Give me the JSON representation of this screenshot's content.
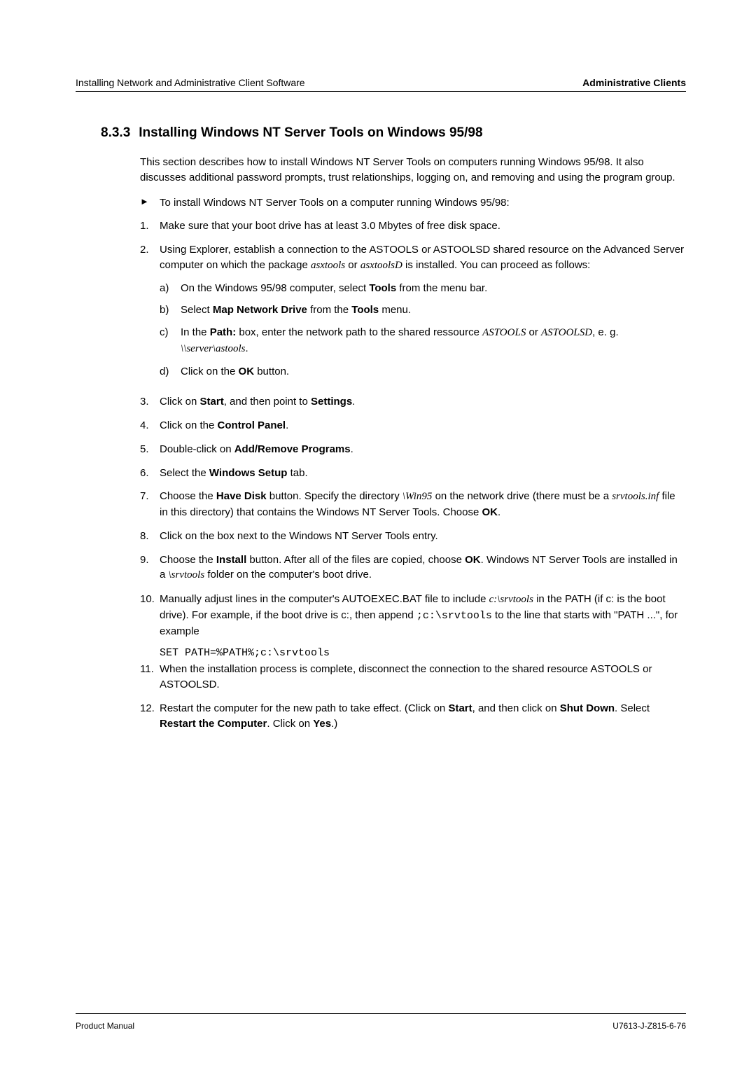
{
  "header": {
    "left": "Installing Network and Administrative Client Software",
    "right": "Administrative Clients"
  },
  "section": {
    "number": "8.3.3",
    "title": "Installing Windows NT Server Tools on Windows 95/98"
  },
  "intro": "This section describes how to install Windows NT Server Tools on computers running Windows 95/98. It also discusses additional password prompts, trust relationships, logging on, and removing and using the program group.",
  "bullet": {
    "marker": "►",
    "text": "To install Windows NT Server Tools on a computer running Windows 95/98:"
  },
  "steps": {
    "s1": "Make sure that your boot drive has at least 3.0 Mbytes of free disk space.",
    "s2_pre": "Using Explorer, establish a connection to the ASTOOLS or ASTOOLSD shared resource on the Advanced Server computer on which the package ",
    "s2_pkg1": "asxtools",
    "s2_or": " or ",
    "s2_pkg2": "asxtoolsD",
    "s2_post": " is installed. You can proceed as follows:",
    "s2a_pre": "On the Windows 95/98 computer, select ",
    "s2a_bold": "Tools",
    "s2a_post": " from the menu bar.",
    "s2b_pre": "Select ",
    "s2b_bold1": "Map Network Drive",
    "s2b_mid": " from the ",
    "s2b_bold2": "Tools",
    "s2b_post": " menu.",
    "s2c_pre": "In the ",
    "s2c_bold": "Path:",
    "s2c_mid": " box, enter the network path to the shared ressource ",
    "s2c_i1": "ASTOOLS",
    "s2c_or": " or ",
    "s2c_i2": "ASTOOLSD",
    "s2c_eg": ", e. g. ",
    "s2c_path": "\\\\server\\astools",
    "s2c_end": ".",
    "s2d_pre": "Click on the ",
    "s2d_bold": "OK",
    "s2d_post": " button.",
    "s3_pre": "Click on ",
    "s3_b1": "Start",
    "s3_mid": ", and then point to ",
    "s3_b2": "Settings",
    "s3_post": ".",
    "s4_pre": "Click on the ",
    "s4_b": "Control Panel",
    "s4_post": ".",
    "s5_pre": "Double-click on ",
    "s5_b": "Add/Remove Programs",
    "s5_post": ".",
    "s6_pre": "Select the ",
    "s6_b": "Windows Setup",
    "s6_post": " tab.",
    "s7_pre": "Choose the ",
    "s7_b1": "Have Disk",
    "s7_mid1": " button. Specify the directory ",
    "s7_i1": "\\Win95",
    "s7_mid2": " on the network drive (there must be a ",
    "s7_i2": "srvtools.inf",
    "s7_mid3": " file in this directory) that contains the Windows NT Server Tools. Choose ",
    "s7_b2": "OK",
    "s7_post": ".",
    "s8": "Click on the box next to the Windows NT Server Tools entry.",
    "s9_pre": "Choose the ",
    "s9_b1": "Install",
    "s9_mid1": " button. After all of the files are copied, choose ",
    "s9_b2": "OK",
    "s9_mid2": ". Windows NT Server Tools are installed in a ",
    "s9_i": "\\srvtools",
    "s9_post": " folder on the computer's boot drive.",
    "s10_pre": "Manually adjust lines in the computer's AUTOEXEC.BAT file to include ",
    "s10_i": "c:\\srvtools",
    "s10_mid1": " in the PATH (if c: is the boot drive). For example, if the boot drive is c:, then append ",
    "s10_code1": ";c:\\srvtools",
    "s10_mid2": " to the line that starts with \"PATH ...\", for example",
    "s10_codeblock": "SET PATH=%PATH%;c:\\srvtools",
    "s11": "When the installation process is complete, disconnect the connection to the shared resource ASTOOLS or ASTOOLSD.",
    "s12_pre": "Restart the computer for the new path to take effect. (Click on ",
    "s12_b1": "Start",
    "s12_mid1": ", and then click on ",
    "s12_b2": "Shut Down",
    "s12_mid2": ". Select ",
    "s12_b3": "Restart the Computer",
    "s12_mid3": ".  Click on ",
    "s12_b4": "Yes",
    "s12_post": ".)"
  },
  "markers": {
    "n1": "1.",
    "n2": "2.",
    "n3": "3.",
    "n4": "4.",
    "n5": "5.",
    "n6": "6.",
    "n7": "7.",
    "n8": "8.",
    "n9": "9.",
    "n10": "10.",
    "n11": "11.",
    "n12": "12.",
    "a": "a)",
    "b": "b)",
    "c": "c)",
    "d": "d)"
  },
  "footer": {
    "left": "Product Manual",
    "right": "U7613-J-Z815-6-76"
  }
}
